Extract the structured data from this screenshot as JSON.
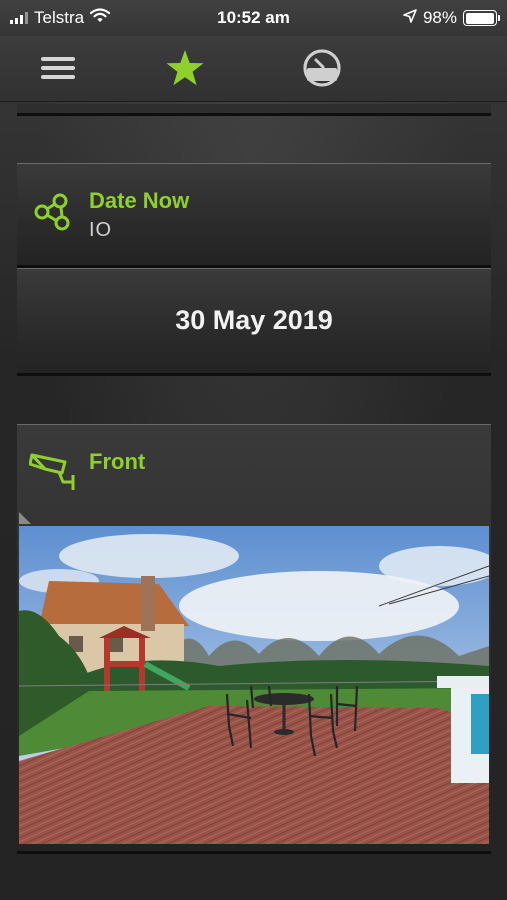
{
  "status_bar": {
    "carrier": "Telstra",
    "time": "10:52 am",
    "battery_percent": "98%",
    "battery_level": 0.98
  },
  "nav": {
    "menu_icon": "hamburger-menu-icon",
    "favorites_icon": "star-icon",
    "dashboard_icon": "gauge-icon",
    "accent_color": "#8fd12a"
  },
  "cards": {
    "date_widget": {
      "title": "Date Now",
      "subtitle": "IO",
      "icon": "nodes-icon"
    },
    "date_value": "30 May 2019",
    "camera_widget": {
      "title": "Front",
      "icon": "security-camera-icon"
    }
  }
}
